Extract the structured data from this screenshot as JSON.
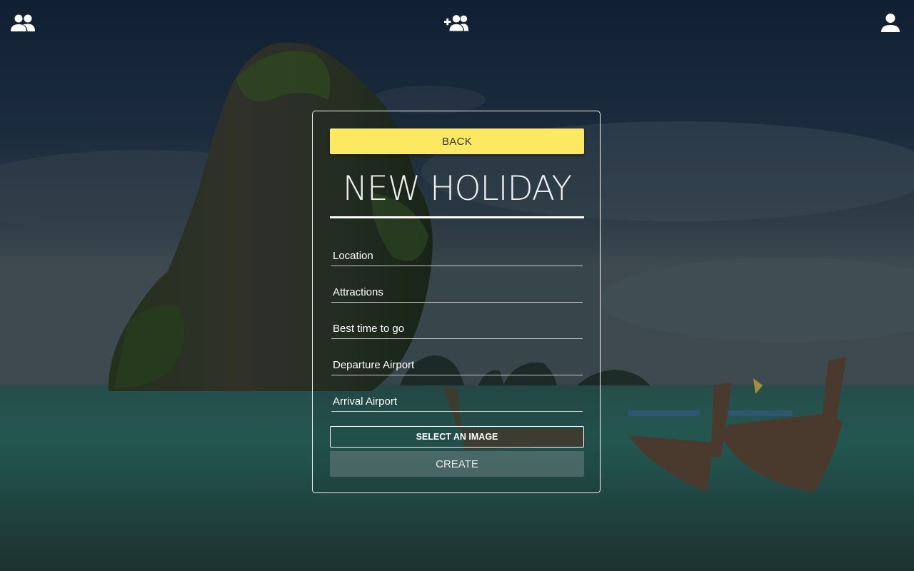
{
  "nav": {
    "friends_icon": "group-icon",
    "add_friend_icon": "group-add-icon",
    "profile_icon": "person-icon"
  },
  "form": {
    "back_label": "BACK",
    "title": "NEW HOLIDAY",
    "fields": [
      {
        "placeholder": "Location",
        "value": ""
      },
      {
        "placeholder": "Attractions",
        "value": ""
      },
      {
        "placeholder": "Best time to go",
        "value": ""
      },
      {
        "placeholder": "Departure Airport",
        "value": ""
      },
      {
        "placeholder": "Arrival Airport",
        "value": ""
      }
    ],
    "select_image_label": "SELECT AN IMAGE",
    "create_label": "CREATE"
  },
  "colors": {
    "accent_yellow": "#fde861",
    "sky": "#1c2b3e",
    "sea": "#2f6a63"
  }
}
